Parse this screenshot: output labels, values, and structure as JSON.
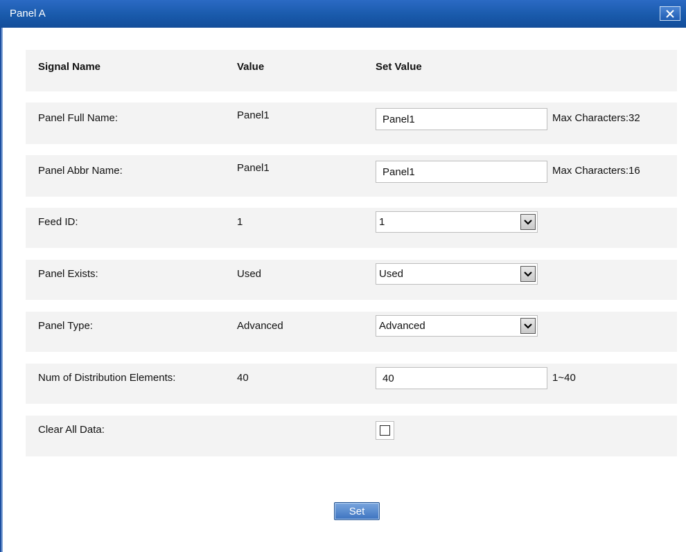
{
  "window": {
    "title": "Panel A",
    "close_icon": "close-icon"
  },
  "table": {
    "headers": {
      "signal_name": "Signal Name",
      "value": "Value",
      "set_value": "Set Value"
    },
    "rows": {
      "full_name": {
        "label": "Panel Full Name:",
        "value": "Panel1",
        "input_value": "Panel1",
        "hint": "Max Characters:32"
      },
      "abbr_name": {
        "label": "Panel Abbr Name:",
        "value": "Panel1",
        "input_value": "Panel1",
        "hint": "Max Characters:16"
      },
      "feed_id": {
        "label": "Feed ID:",
        "value": "1",
        "selected": "1"
      },
      "panel_exists": {
        "label": "Panel Exists:",
        "value": "Used",
        "selected": "Used"
      },
      "panel_type": {
        "label": "Panel Type:",
        "value": "Advanced",
        "selected": "Advanced"
      },
      "num_elements": {
        "label": "Num of Distribution Elements:",
        "value": "40",
        "input_value": "40",
        "hint": "1~40"
      },
      "clear_data": {
        "label": "Clear All Data:",
        "checked": false
      }
    }
  },
  "actions": {
    "set_label": "Set"
  },
  "colors": {
    "titlebar": "#195aab",
    "row_bg": "#f3f3f3",
    "button": "#3c73c0"
  }
}
